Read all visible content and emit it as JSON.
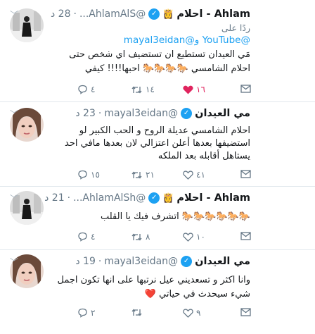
{
  "tweets": [
    {
      "name": "Ahlam - احلام",
      "crown": "👸",
      "handle": "@AhlamAlS...",
      "time": "28 د",
      "reply_to": "ردًا على",
      "mentions": "@YouTube و@mayal3eidan",
      "text1": "مَي العيدان تستطيع ان تستضيف اي شخص حتى",
      "text2": "احلام الشامسي 🐎🐎🐎🐎 احبها!!!! كيفي",
      "replies": "٤",
      "retweets": "١٤",
      "likes": "١٦"
    },
    {
      "name": "مي العيدان",
      "handle": "@mayal3eidan",
      "time": "23 د",
      "text1": "احلام الشامسي عديلة الروح و الحب الكبير  لو",
      "text2": "استضيفها بعدها أعلن اعتزالي لان بعدها مافي احد",
      "text3": "يستاهل أقابله بعد الملكه",
      "replies": "١٥",
      "retweets": "٢١",
      "likes": "٤١"
    },
    {
      "name": "Ahlam - احلام",
      "crown": "👸",
      "handle": "@AhlamAlSh...",
      "time": "21 د",
      "text1": "🐎🐎🐎🐎🐎🐎 اتشرف فيك يا القلب",
      "replies": "٤",
      "retweets": "٨",
      "likes": "١٠"
    },
    {
      "name": "مي العيدان",
      "handle": "@mayal3eidan",
      "time": "19 د",
      "text1": "وانا اكثر و تسعديني عيل نرتبها على انها تكون اجمل",
      "text2": "شيء سيحدث في حياتي ❤️",
      "replies": "٢",
      "retweets": "",
      "likes": "٩"
    }
  ],
  "colors": {
    "accent": "#1da1f2",
    "like": "#e0245e",
    "muted": "#657786"
  }
}
